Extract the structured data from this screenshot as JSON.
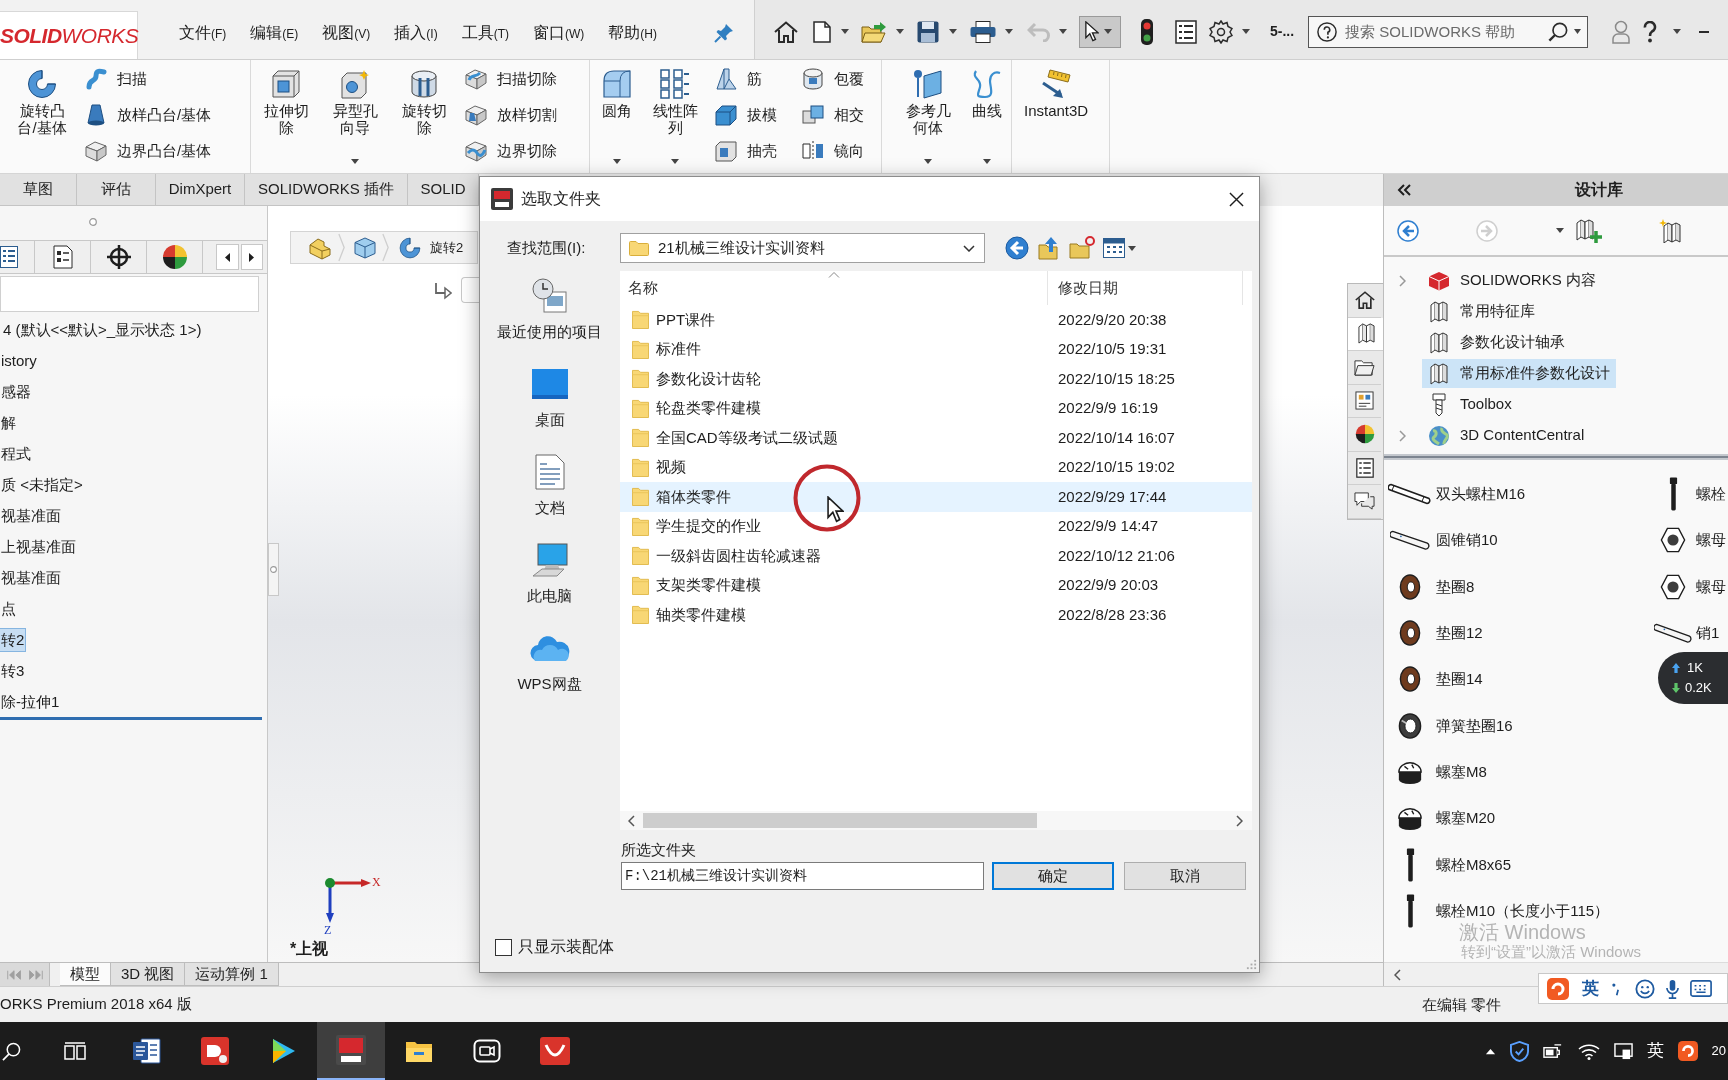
{
  "menu_bar": {
    "logo": "**SOLID**WORKS",
    "menus": [
      {
        "label": "文件",
        "key": "(F)"
      },
      {
        "label": "编辑",
        "key": "(E)"
      },
      {
        "label": "视图",
        "key": "(V)"
      },
      {
        "label": "插入",
        "key": "(I)"
      },
      {
        "label": "工具",
        "key": "(T)"
      },
      {
        "label": "窗口",
        "key": "(W)"
      },
      {
        "label": "帮助",
        "key": "(H)"
      }
    ]
  },
  "quick_access": {
    "undo": {
      "disabled": true
    },
    "select": {
      "selected": true
    },
    "overflow": "5-...",
    "search": {
      "placeholder": "搜索 SOLIDWORKS 帮助"
    }
  },
  "ribbon": {
    "groups": [
      {
        "columns": [
          {
            "kind": "large",
            "label": "旋转凸台/基体",
            "dropdown": false
          },
          {
            "kind": "stack",
            "items": [
              "扫描",
              "放样凸台/基体",
              "边界凸台/基体"
            ]
          }
        ]
      },
      {
        "columns": [
          {
            "kind": "large",
            "label": "拉伸切除",
            "dropdown": false
          },
          {
            "kind": "large",
            "label": "异型孔向导",
            "dropdown": true
          },
          {
            "kind": "large",
            "label": "旋转切除",
            "dropdown": false
          },
          {
            "kind": "stack",
            "items": [
              "扫描切除",
              "放样切割",
              "边界切除"
            ]
          }
        ]
      },
      {
        "columns": [
          {
            "kind": "large",
            "label": "圆角",
            "dropdown": true
          },
          {
            "kind": "large",
            "label": "线性阵列",
            "dropdown": true
          },
          {
            "kind": "stack",
            "items": [
              "筋",
              "拔模",
              "抽壳"
            ]
          },
          {
            "kind": "stack",
            "items": [
              "包覆",
              "相交",
              "镜向"
            ]
          }
        ]
      },
      {
        "columns": [
          {
            "kind": "large",
            "label": "参考几何体",
            "dropdown": true
          },
          {
            "kind": "large",
            "label": "曲线",
            "dropdown": true
          }
        ]
      },
      {
        "columns": [
          {
            "kind": "large",
            "label": "Instant3D",
            "dropdown": false
          }
        ]
      }
    ]
  },
  "command_tabs": [
    {
      "label": "草图",
      "selected": false
    },
    {
      "label": "评估",
      "selected": false
    },
    {
      "label": "DimXpert",
      "selected": false
    },
    {
      "label": "SOLIDWORKS 插件",
      "selected": false
    },
    {
      "label": "SOLID",
      "selected": false
    }
  ],
  "feature_manager": {
    "tree": [
      {
        "label": "4 (默认<<默认>_显示状态 1>)",
        "selected": false
      },
      {
        "label": "istory",
        "selected": false
      },
      {
        "label": "感器",
        "selected": false
      },
      {
        "label": "解",
        "selected": false
      },
      {
        "label": "程式",
        "selected": false
      },
      {
        "label": "质 <未指定>",
        "selected": false
      },
      {
        "label": "视基准面",
        "selected": false
      },
      {
        "label": "上视基准面",
        "selected": false
      },
      {
        "label": "视基准面",
        "selected": false
      },
      {
        "label": "点",
        "selected": false
      },
      {
        "label": "转2",
        "selected": true
      },
      {
        "label": "转3",
        "selected": false
      },
      {
        "label": "除-拉伸1",
        "selected": false
      }
    ]
  },
  "graphics": {
    "breadcrumb": "旋转2",
    "view_name": "*上视",
    "axes": [
      "X",
      "Z"
    ]
  },
  "task_pane_tabs": [
    {
      "selected": false
    },
    {
      "selected": true
    },
    {
      "selected": false
    },
    {
      "selected": false
    },
    {
      "selected": false
    },
    {
      "selected": false
    },
    {
      "selected": false
    }
  ],
  "model_tabs": [
    {
      "label": "模型",
      "selected": true
    },
    {
      "label": "3D 视图",
      "selected": false
    },
    {
      "label": "运动算例 1",
      "selected": false
    }
  ],
  "design_library": {
    "title": "设计库",
    "tree": [
      {
        "label": "SOLIDWORKS 内容",
        "expandable": true,
        "selected": false
      },
      {
        "label": "常用特征库",
        "expandable": false,
        "selected": false
      },
      {
        "label": "参数化设计轴承",
        "expandable": false,
        "selected": false
      },
      {
        "label": "常用标准件参数化设计",
        "expandable": false,
        "selected": true
      },
      {
        "label": "Toolbox",
        "expandable": false,
        "selected": false
      },
      {
        "label": "3D ContentCentral",
        "expandable": true,
        "selected": false
      }
    ],
    "left_column": [
      {
        "label": "双头螺柱M16",
        "kind": "stud"
      },
      {
        "label": "圆锥销10",
        "kind": "pin"
      },
      {
        "label": "垫圈8",
        "kind": "washer"
      },
      {
        "label": "垫圈12",
        "kind": "washer"
      },
      {
        "label": "垫圈14",
        "kind": "washer"
      },
      {
        "label": "弹簧垫圈16",
        "kind": "spring_washer"
      },
      {
        "label": "螺塞M8",
        "kind": "plug"
      },
      {
        "label": "螺塞M20",
        "kind": "plug"
      },
      {
        "label": "螺栓M8x65",
        "kind": "bolt"
      },
      {
        "label": "螺栓M10（长度小于115）",
        "kind": "bolt"
      }
    ],
    "right_column": [
      {
        "label": "螺栓",
        "kind": "bolt"
      },
      {
        "label": "螺母",
        "kind": "nut"
      },
      {
        "label": "螺母",
        "kind": "nut"
      },
      {
        "label": "销1",
        "kind": "pin"
      }
    ]
  },
  "status_bar": {
    "product": "ORKS Premium 2018 x64 版",
    "mode": "在编辑 零件"
  },
  "dialog": {
    "title": "选取文件夹",
    "look_in_label": "查找范围(I):",
    "look_in": "21机械三维设计实训资料",
    "places": [
      "最近使用的项目",
      "桌面",
      "文档",
      "此电脑",
      "WPS网盘"
    ],
    "columns": [
      "名称",
      "修改日期"
    ],
    "rows": [
      {
        "name": "PPT课件",
        "date": "2022/9/20 20:38",
        "hovered": false
      },
      {
        "name": "标准件",
        "date": "2022/10/5 19:31",
        "hovered": false
      },
      {
        "name": "参数化设计齿轮",
        "date": "2022/10/15 18:25",
        "hovered": false
      },
      {
        "name": "轮盘类零件建模",
        "date": "2022/9/9 16:19",
        "hovered": false
      },
      {
        "name": "全国CAD等级考试二级试题",
        "date": "2022/10/14 16:07",
        "hovered": false
      },
      {
        "name": "视频",
        "date": "2022/10/15 19:02",
        "hovered": false
      },
      {
        "name": "箱体类零件",
        "date": "2022/9/29 17:44",
        "hovered": true
      },
      {
        "name": "学生提交的作业",
        "date": "2022/9/9 14:47",
        "hovered": false
      },
      {
        "name": "一级斜齿圆柱齿轮减速器",
        "date": "2022/10/12 21:06",
        "hovered": false
      },
      {
        "name": "支架类零件建模",
        "date": "2022/9/9 20:03",
        "hovered": false
      },
      {
        "name": "轴类零件建模",
        "date": "2022/8/28 23:36",
        "hovered": false
      }
    ],
    "selected_label": "所选文件夹",
    "selected_path": "F:\\21机械三维设计实训资料",
    "buttons": [
      {
        "label": "确定",
        "default": true
      },
      {
        "label": "取消",
        "default": false
      }
    ],
    "assembly_only": {
      "label": "只显示装配体",
      "checked": false
    }
  },
  "network_speed": {
    "upload": "1K",
    "download": "0.2K"
  },
  "activation_notice": {
    "title": "激活 Windows",
    "hint": "转到“设置”以激活 Windows"
  },
  "ime_bar": {
    "mode": "英"
  },
  "taskbar": {
    "apps": [
      {
        "active": false
      },
      {
        "active": false
      },
      {
        "active": false
      },
      {
        "active": true
      },
      {
        "active": false
      },
      {
        "active": false
      },
      {
        "active": false
      }
    ],
    "ime": "英",
    "clock": "20"
  }
}
